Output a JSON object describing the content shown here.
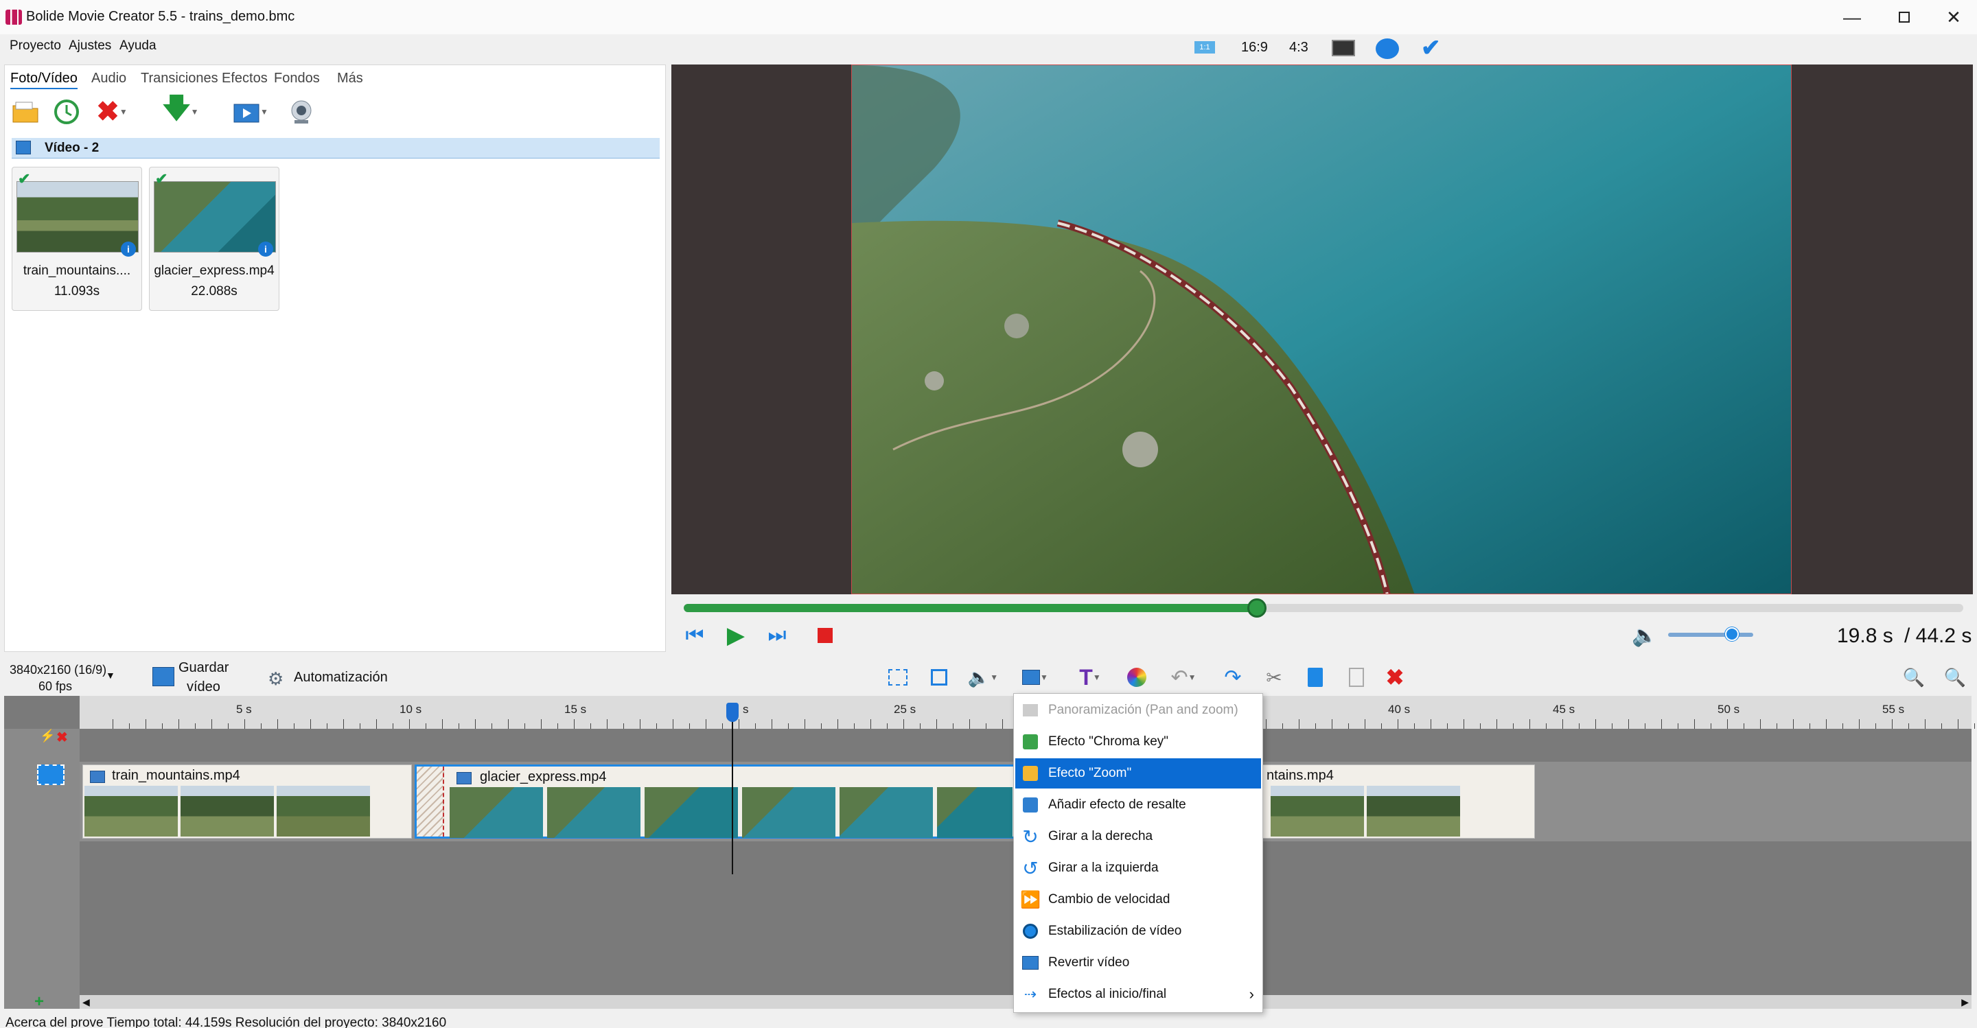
{
  "window": {
    "title": "Bolide Movie Creator 5.5 - trains_demo.bmc",
    "minimize_icon": "minimize-icon",
    "maximize_icon": "maximize-icon",
    "close_icon": "close-icon"
  },
  "menu": {
    "items": [
      "Proyecto",
      "Ajustes",
      "Ayuda"
    ]
  },
  "aspect_bar": {
    "ratio_one": "1:1",
    "ratio_wide": "16:9",
    "ratio_std": "4:3"
  },
  "library": {
    "tabs": [
      "Foto/Vídeo",
      "Audio",
      "Transiciones",
      "Efectos",
      "Fondos",
      "Más"
    ],
    "group_title": "Vídeo - 2",
    "files": [
      {
        "name": "train_mountains....",
        "duration": "11.093s"
      },
      {
        "name": "glacier_express.mp4",
        "duration": "22.088s"
      }
    ]
  },
  "player": {
    "progress": 0.448,
    "current_time": "19.8 s",
    "total_time": "/ 44.2 s",
    "volume": 0.75
  },
  "project": {
    "resolution": "3840x2160 (16/9)",
    "fps": "60 fps",
    "save_line1": "Guardar",
    "save_line2": "vídeo",
    "automation": "Automatización"
  },
  "timeline": {
    "ticks": [
      "5 s",
      "10 s",
      "15 s",
      "s",
      "25 s",
      "40 s",
      "45 s",
      "50 s",
      "55 s"
    ],
    "clips": [
      "train_mountains.mp4",
      "glacier_express.mp4",
      "ntains.mp4"
    ]
  },
  "context_menu": {
    "items": [
      {
        "label": "Panoramización (Pan and zoom)",
        "icon": "pan-zoom-icon",
        "disabled": true
      },
      {
        "label": "Efecto \"Chroma key\"",
        "icon": "chroma-key-icon"
      },
      {
        "label": "Efecto \"Zoom\"",
        "icon": "zoom-effect-icon",
        "selected": true
      },
      {
        "label": "Añadir efecto de resalte",
        "icon": "highlight-icon"
      },
      {
        "label": "Girar a la derecha",
        "icon": "rotate-right-icon"
      },
      {
        "label": "Girar a la izquierda",
        "icon": "rotate-left-icon"
      },
      {
        "label": "Cambio de velocidad",
        "icon": "speed-icon"
      },
      {
        "label": "Estabilización de vídeo",
        "icon": "stabilize-icon"
      },
      {
        "label": "Revertir vídeo",
        "icon": "reverse-icon"
      },
      {
        "label": "Efectos al inicio/final",
        "icon": "start-end-effects-icon",
        "submenu": true
      }
    ]
  },
  "status": {
    "text": "Acerca del prove Tiempo total: 44.159s    Resolución del proyecto:  3840x2160"
  }
}
